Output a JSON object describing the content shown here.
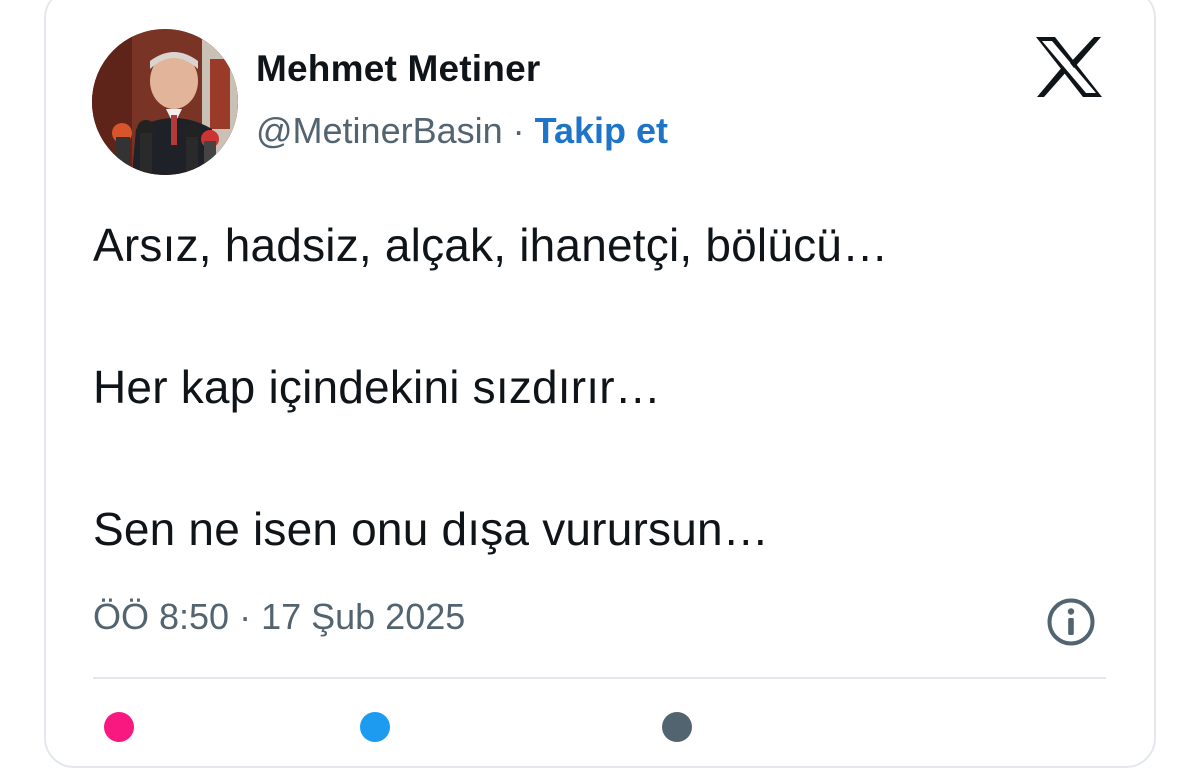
{
  "tweet": {
    "author_name": "Mehmet Metiner",
    "handle": "@MetinerBasin",
    "separator": "·",
    "follow_label": "Takip et",
    "lines": [
      "Arsız, hadsiz, alçak, ihanetçi, bölücü…",
      "Her kap içindekini sızdırır…",
      "Sen ne isen onu dışa vurursun…"
    ],
    "timestamp": "ÖÖ 8:50 · 17 Şub 2025"
  },
  "icons": {
    "platform_logo": "x-logo-icon",
    "info": "info-icon",
    "actions": [
      "heart-icon",
      "reply-icon",
      "copy-link-icon"
    ]
  },
  "colors": {
    "text": "#0f1419",
    "secondary": "#536471",
    "follow": "#1d74c9",
    "border": "#e4e8ec",
    "like": "#f91880",
    "reply": "#1d9bf0"
  }
}
